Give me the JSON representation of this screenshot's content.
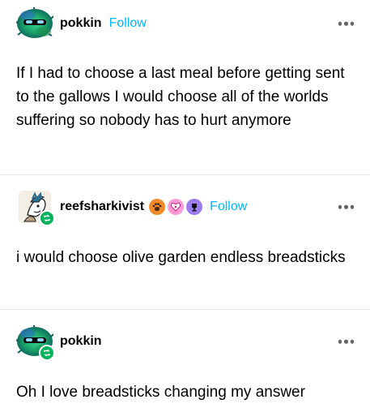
{
  "posts": [
    {
      "username": "pokkin",
      "follow_label": "Follow",
      "body": "If I had to choose a last meal before getting sent to the gallows I would choose all of the worlds suffering so nobody has to hurt anymore",
      "reblog": false
    },
    {
      "username": "reefsharkivist",
      "follow_label": "Follow",
      "body": "i would choose olive garden endless breadsticks",
      "reblog": true
    },
    {
      "username": "pokkin",
      "body": "Oh I love breadsticks changing my answer",
      "reblog": true
    }
  ],
  "colors": {
    "follow": "#00b8ff",
    "reblog_badge": "#00b35a",
    "divider": "#e6e6e6",
    "more_dots": "#666666"
  },
  "icons": {
    "more": "more-options-icon",
    "reblog": "reblog-icon",
    "badges": [
      "pawprint-badge-icon",
      "heart-paws-badge-icon",
      "trophy-badge-icon"
    ]
  }
}
